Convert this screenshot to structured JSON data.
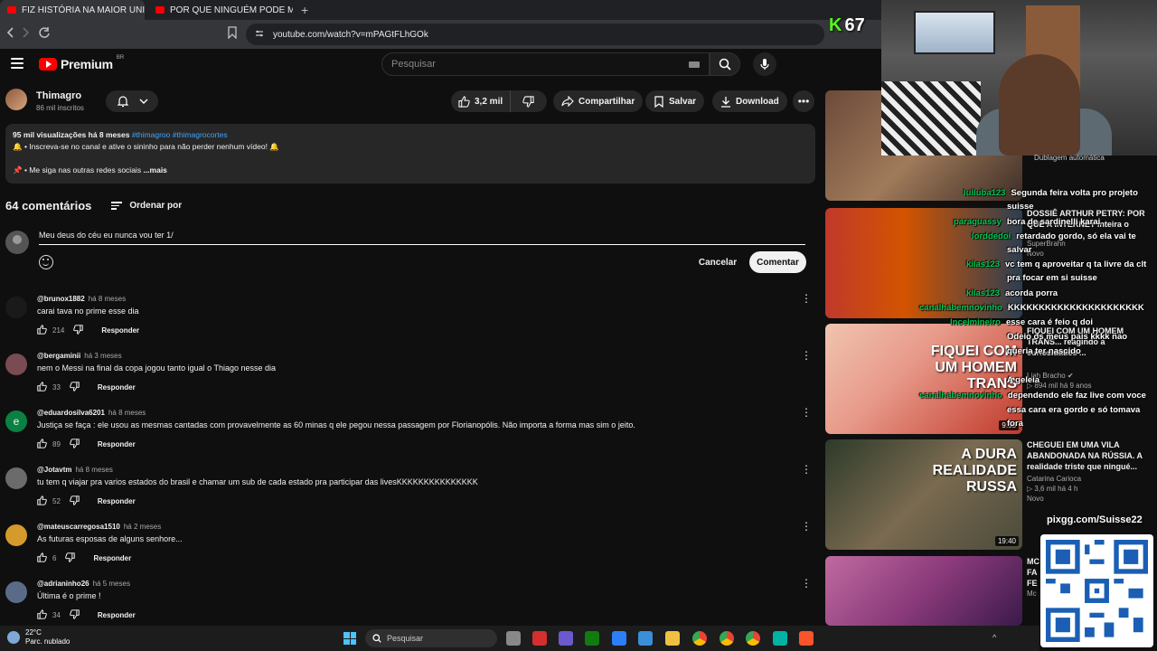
{
  "browser": {
    "tabs": [
      {
        "label": "FIZ HISTÓRIA NA MAIOR UNIVE",
        "active": true
      },
      {
        "label": "POR QUE NINGUÉM PODE MORAR N",
        "active": false
      }
    ],
    "close": "×",
    "new_tab": "+",
    "url": "youtube.com/watch?v=mPAGtFLhGOk"
  },
  "header": {
    "brand": "Premium",
    "country": "BR",
    "search_placeholder": "Pesquisar"
  },
  "channel": {
    "name": "Thimagro",
    "subs": "86 mil inscritos",
    "likes": "3,2 mil",
    "share": "Compartilhar",
    "save": "Salvar",
    "download": "Download"
  },
  "description": {
    "meta": "95 mil visualizações  há 8 meses",
    "tags": "#thimagroo #thimagrocortes",
    "line1": "🔔 • Inscreva-se no canal e ative o sininho para não perder nenhum vídeo! 🔔",
    "line2": "📌 • Me siga nas outras redes sociais",
    "more": "...mais"
  },
  "comments_header": {
    "count": "64 comentários",
    "sort": "Ordenar por"
  },
  "comment_box": {
    "value": "Meu deus do céu eu nunca vou ter 1/",
    "cancel": "Cancelar",
    "submit": "Comentar"
  },
  "reply_label": "Responder",
  "comments": [
    {
      "author": "@brunox1882",
      "time": "há 8 meses",
      "text": "carai tava no prime esse dia",
      "likes": "214",
      "avatar_color": "#1a1a1a"
    },
    {
      "author": "@bergaminii",
      "time": "há 3 meses",
      "text": "nem o Messi na final da copa jogou tanto igual o Thiago nesse dia",
      "likes": "33",
      "avatar_color": "#7a4b52"
    },
    {
      "author": "@eduardosilva6201",
      "time": "há 8 meses",
      "text": "Justiça se faça : ele usou as mesmas cantadas com provavelmente as 60 minas q ele pegou nessa passagem por Florianopólis. Não importa a forma mas sim o jeito.",
      "likes": "89",
      "avatar_color": "#0b8043",
      "initial": "e"
    },
    {
      "author": "@Jotavtm",
      "time": "há 8 meses",
      "text": "tu tem q viajar pra varios estados do brasil e chamar um sub  de cada estado pra participar das livesKKKKKKKKKKKKKKK",
      "likes": "52",
      "avatar_color": "#6b6b6b"
    },
    {
      "author": "@mateuscarregosa1510",
      "time": "há 2 meses",
      "text": "As futuras esposas de alguns senhore...",
      "likes": "6",
      "avatar_color": "#d49b2c"
    },
    {
      "author": "@adrianinho26",
      "time": "há 5 meses",
      "text": "Última é o prime !",
      "likes": "34",
      "avatar_color": "#5a6b8a"
    }
  ],
  "sidebar": {
    "videos": [
      {
        "overlay": "",
        "title": "",
        "channel": "",
        "meta": "",
        "duration": ""
      },
      {
        "overlay": "",
        "title": "DOSSIÊ ARTHUR PETRY: POR QUE A INTERNET inteira o",
        "channel": "SuperBrahh",
        "meta": "",
        "badge": "Novo",
        "duration": ""
      },
      {
        "overlay": "FIQUEI COM UM HOMEM TRANS",
        "title": "FIQUEI COM UM HOMEM TRANS... reagindo a curiosidades ...",
        "channel": "Liah Bracho ✔",
        "meta": "▷ 894 mil  há 9 anos",
        "duration": "9:55"
      },
      {
        "overlay": "A DURA REALIDADE RUSSA",
        "title": "CHEGUEI EM UMA VILA ABANDONADA NA RÚSSIA. A realidade triste que ningué...",
        "channel": "Catarina Carioca",
        "meta": "▷ 3,6 mil  há 4 h",
        "badge": "Novo",
        "duration": "19:40"
      },
      {
        "overlay": "",
        "title": "MC FA FE",
        "channel": "Mc",
        "meta": "",
        "duration": ""
      }
    ]
  },
  "chat": [
    {
      "user": "luiluba123",
      "msg": "Segunda feira volta pro projeto"
    },
    {
      "user": "",
      "msg": "suisse"
    },
    {
      "user": "paraguassy",
      "msg": "bora de sardinelli karai"
    },
    {
      "user": "lorddedoi",
      "msg": "retardado gordo, só ela vai te"
    },
    {
      "user": "",
      "msg": "salvar"
    },
    {
      "user": "kilas123",
      "msg": "vc tem q aproveitar q ta livre da clt"
    },
    {
      "user": "",
      "msg": "pra focar em si suisse"
    },
    {
      "user": "kilas123",
      "msg": "acorda porra"
    },
    {
      "user": "canalhabemnovinho",
      "msg": "KKKKKKKKKKKKKKKKKKKKKK"
    },
    {
      "user": "lncelmineiro",
      "msg": "esse cara é feio q doi"
    },
    {
      "user": "",
      "msg": "Odeio os meus pais kkkk nao"
    },
    {
      "user": "",
      "msg": "queria ter nascido"
    },
    {
      "user": "",
      "msg": "A geleia"
    },
    {
      "user": "canalhabemnovinho",
      "msg": "dependendo ele faz live com voce"
    },
    {
      "user": "",
      "msg": "essa cara era gordo e só tomava"
    },
    {
      "user": "",
      "msg": "fora"
    }
  ],
  "stream": {
    "kick_label": "K",
    "viewers": "67",
    "dub_label": "Dublagem automática",
    "qr_label": "pixgg.com/Suisse22"
  },
  "taskbar": {
    "temp": "22°C",
    "weather": "Parc. nublado",
    "search": "Pesquisar"
  },
  "colors": {
    "accent_red": "#ff0000",
    "link_blue": "#3ea6ff",
    "chat_green": "#00c853",
    "kick_green": "#53fc18"
  }
}
